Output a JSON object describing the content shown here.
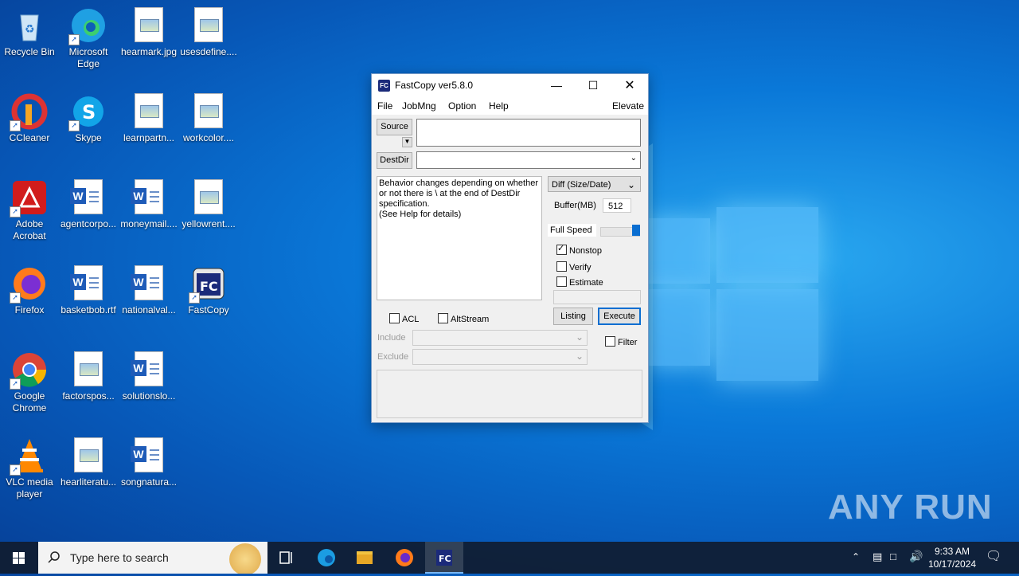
{
  "desktop": {
    "icons": [
      {
        "label": "Recycle Bin",
        "icon": "recycle-bin-icon"
      },
      {
        "label": "Microsoft Edge",
        "icon": "edge-icon"
      },
      {
        "label": "hearmark.jpg",
        "icon": "image-file-icon"
      },
      {
        "label": "usesdefine....",
        "icon": "image-file-icon"
      },
      {
        "label": "CCleaner",
        "icon": "ccleaner-icon"
      },
      {
        "label": "Skype",
        "icon": "skype-icon"
      },
      {
        "label": "learnpartn...",
        "icon": "image-file-icon"
      },
      {
        "label": "workcolor....",
        "icon": "image-file-icon"
      },
      {
        "label": "Adobe Acrobat",
        "icon": "acrobat-icon"
      },
      {
        "label": "agentcorpo...",
        "icon": "word-doc-icon"
      },
      {
        "label": "moneymail....",
        "icon": "word-doc-icon"
      },
      {
        "label": "yellowrent....",
        "icon": "image-file-icon"
      },
      {
        "label": "Firefox",
        "icon": "firefox-icon"
      },
      {
        "label": "basketbob.rtf",
        "icon": "word-doc-icon"
      },
      {
        "label": "nationalval...",
        "icon": "word-doc-icon"
      },
      {
        "label": "FastCopy",
        "icon": "fastcopy-icon"
      },
      {
        "label": "Google Chrome",
        "icon": "chrome-icon"
      },
      {
        "label": "factorspos...",
        "icon": "image-file-icon"
      },
      {
        "label": "solutionslo...",
        "icon": "word-doc-icon"
      },
      {
        "label": "VLC media player",
        "icon": "vlc-icon"
      },
      {
        "label": "hearliteratu...",
        "icon": "image-file-icon"
      },
      {
        "label": "songnatura...",
        "icon": "word-doc-icon"
      }
    ]
  },
  "window": {
    "title": "FastCopy ver5.8.0",
    "menu": [
      "File",
      "JobMng",
      "Option",
      "Help",
      "Elevate"
    ],
    "source_label": "Source",
    "source_value": "",
    "destdir_label": "DestDir",
    "destdir_value": "",
    "info_text": "Behavior changes depending on whether or not there is \\ at the end of DestDir specification.\n(See Help for details)",
    "mode": "Diff (Size/Date)",
    "buffer_label": "Buffer(MB)",
    "buffer_value": "512",
    "speed_label": "Full Speed",
    "nonstop_label": "Nonstop",
    "nonstop_checked": true,
    "verify_label": "Verify",
    "verify_checked": false,
    "estimate_label": "Estimate",
    "estimate_checked": false,
    "acl_label": "ACL",
    "altstream_label": "AltStream",
    "listing_label": "Listing",
    "execute_label": "Execute",
    "include_label": "Include",
    "exclude_label": "Exclude",
    "filter_label": "Filter"
  },
  "taskbar": {
    "search_placeholder": "Type here to search",
    "time": "9:33 AM",
    "date": "10/17/2024"
  },
  "watermark": "ANY RUN"
}
